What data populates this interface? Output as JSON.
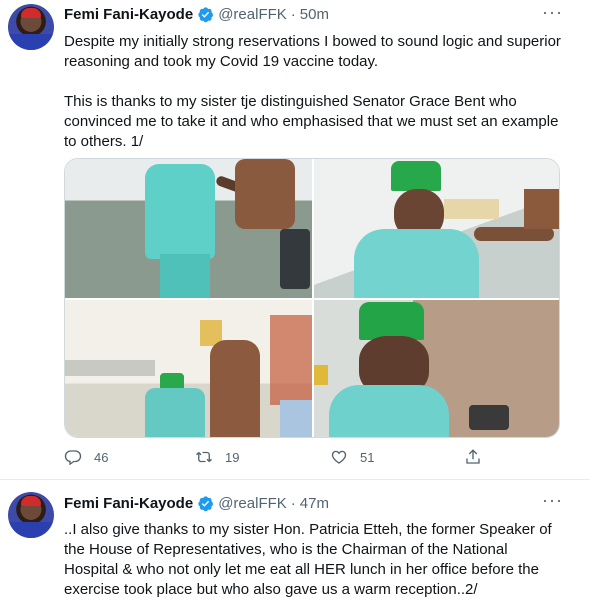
{
  "tweets": [
    {
      "author": {
        "name": "Femi Fani-Kayode",
        "handle": "@realFFK"
      },
      "separator": "·",
      "time": "50m",
      "paragraphs": [
        "Despite my initially strong reservations I bowed to sound logic and superior reasoning and took my Covid 19 vaccine today.",
        "This is thanks to my sister tje distinguished Senator Grace Bent who convinced me to take it and who emphasised that we must set an example to others. 1/"
      ],
      "media": {
        "photos": [
          "photo-vaccination-arm",
          "photo-vaccination-smiling",
          "photo-hospital-room",
          "photo-closeup-green-cap"
        ]
      },
      "stats": {
        "replies": "46",
        "retweets": "19",
        "likes": "51"
      }
    },
    {
      "author": {
        "name": "Femi Fani-Kayode",
        "handle": "@realFFK"
      },
      "separator": "·",
      "time": "47m",
      "paragraphs": [
        "..I also give thanks to my sister Hon. Patricia Etteh, the former Speaker of the House of Representatives, who is the Chairman of the National Hospital & who not only let me eat all HER lunch in her office before the exercise took place but who also gave us a warm reception..2/"
      ]
    }
  ],
  "icons": {
    "verified": "verified-badge-icon",
    "more": "more-options-icon",
    "reply": "reply-icon",
    "retweet": "retweet-icon",
    "like": "heart-icon",
    "share": "share-icon"
  },
  "colors": {
    "verified": "#1d9bf0",
    "text": "#0f1419",
    "secondary": "#536471",
    "border": "#cfd9de"
  }
}
